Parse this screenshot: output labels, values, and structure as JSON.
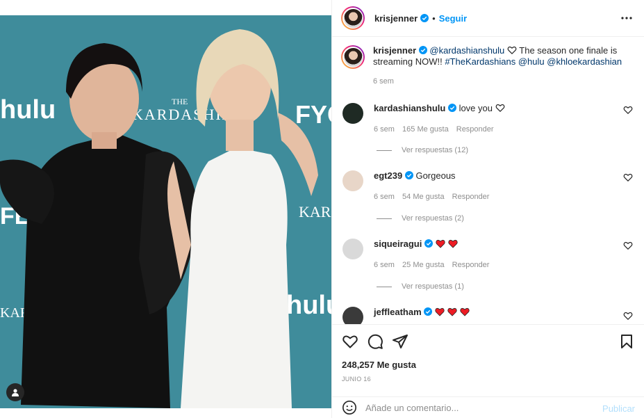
{
  "header": {
    "username": "krisjenner",
    "separator": "•",
    "follow_label": "Seguir",
    "more_icon": "more-dots-icon"
  },
  "caption": {
    "username": "krisjenner",
    "mention_1": "@kardashianshulu",
    "text_1": "The season one finale is streaming NOW!!",
    "hashtag": "#TheKardashians",
    "mention_2": "@hulu",
    "mention_3": "@khloekardashian",
    "time": "6 sem"
  },
  "comments": [
    {
      "username": "kardashianshulu",
      "text": "love you",
      "time": "6 sem",
      "likes": "165 Me gusta",
      "reply_label": "Responder",
      "replies": "Ver respuestas (12)",
      "avatar_color": "#1f2a24"
    },
    {
      "username": "egt239",
      "text": "Gorgeous",
      "time": "6 sem",
      "likes": "54 Me gusta",
      "reply_label": "Responder",
      "replies": "Ver respuestas (2)",
      "avatar_color": "#e8d6c8"
    },
    {
      "username": "siqueiragui",
      "text": "",
      "time": "6 sem",
      "likes": "25 Me gusta",
      "reply_label": "Responder",
      "replies": "Ver respuestas (1)",
      "avatar_color": "#d9d9d9"
    },
    {
      "username": "jeffleatham",
      "text": "",
      "avatar_color": "#3a3a3a"
    }
  ],
  "actions": {
    "likes": "248,257 Me gusta",
    "date": "JUNIO 16"
  },
  "add_comment": {
    "placeholder": "Añade un comentario...",
    "publish_label": "Publicar"
  },
  "photo": {
    "backdrop_text_1": "hulu",
    "backdrop_text_2": "THE",
    "backdrop_text_3": "KARDASHIANS",
    "backdrop_text_4": "FYC",
    "backdrop_text_5": "FEST"
  },
  "colors": {
    "accent": "#0095f6",
    "verified": "#0095f6",
    "heart_red": "#ed4956",
    "backdrop": "#3d8a9a"
  }
}
